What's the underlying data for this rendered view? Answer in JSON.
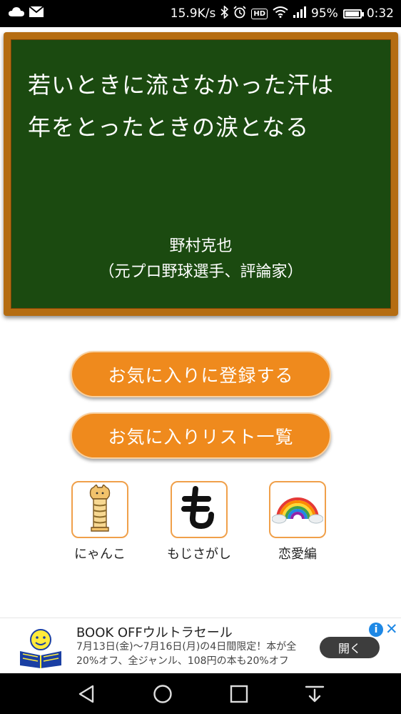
{
  "status_bar": {
    "network_speed": "15.9K/s",
    "hd_badge": "HD",
    "battery_percent": "95%",
    "battery_level": 0.95,
    "time": "0:32"
  },
  "quote": {
    "line1": "若いときに流さなかった汗は",
    "line2": "年をとったときの涙となる",
    "author_name": "野村克也",
    "author_title": "（元プロ野球選手、評論家）"
  },
  "buttons": {
    "add_favorite": "お気に入りに登録する",
    "favorite_list": "お気に入りリスト一覧"
  },
  "categories": [
    {
      "label": "にゃんこ",
      "icon": "cat-tower-icon"
    },
    {
      "label": "もじさがし",
      "icon": "mo-character-icon"
    },
    {
      "label": "恋愛編",
      "icon": "rainbow-icon"
    }
  ],
  "ad": {
    "title": "BOOK OFFウルトラセール",
    "desc_line1": "7月13日(金)〜7月16日(月)の4日間限定！本が全",
    "desc_line2": "20%オフ、全ジャンル、108円の本も20%オフ",
    "open_button": "開く",
    "info_glyph": "i",
    "close_glyph": "✕"
  },
  "colors": {
    "board_green": "#1b4a10",
    "board_frame": "#b56d12",
    "button_orange": "#ef8a1d"
  }
}
